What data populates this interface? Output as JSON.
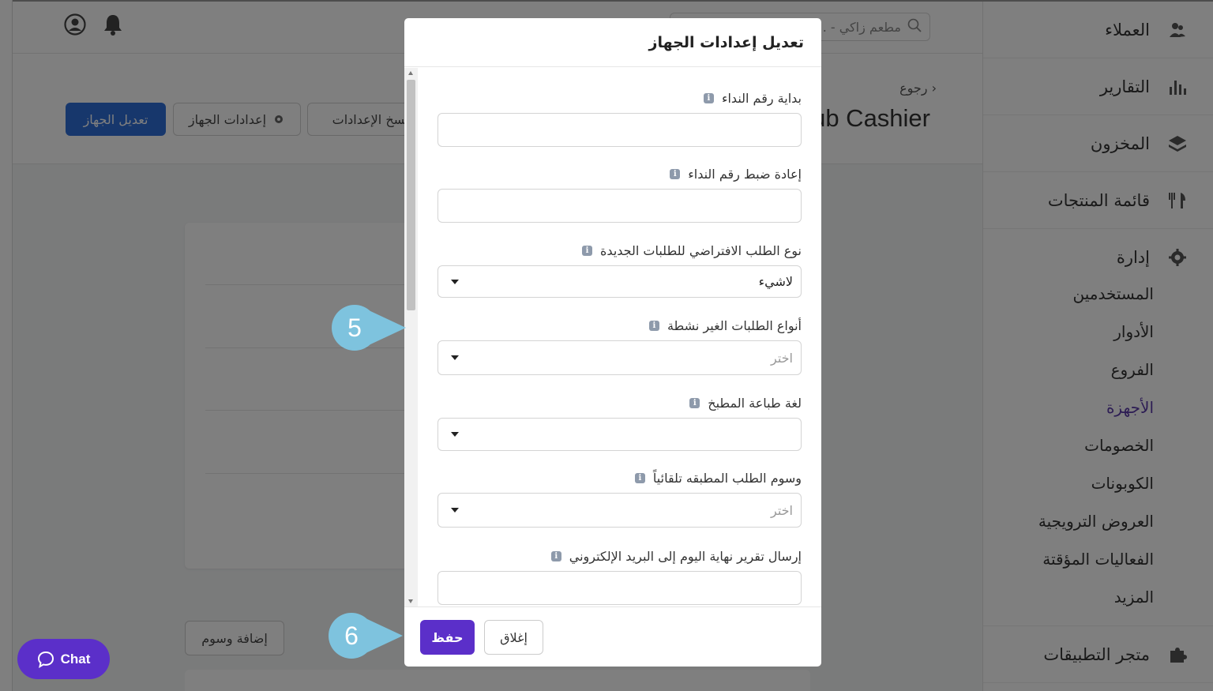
{
  "sidebar": {
    "items_top": [
      {
        "label": "العملاء",
        "icon": "customers-icon"
      },
      {
        "label": "التقارير",
        "icon": "reports-icon"
      },
      {
        "label": "المخزون",
        "icon": "inventory-icon"
      },
      {
        "label": "قائمة المنتجات",
        "icon": "menu-icon"
      }
    ],
    "management": {
      "label": "إدارة",
      "subitems": [
        "المستخدمين",
        "الأدوار",
        "الفروع",
        "الأجهزة",
        "الخصومات",
        "الكوبونات",
        "العروض الترويجية",
        "الفعاليات المؤقتة",
        "المزيد"
      ],
      "active": "الأجهزة"
    },
    "marketplace": {
      "label": "متجر التطبيقات"
    }
  },
  "topbar": {
    "search_placeholder": "مطعم زاكي - ..."
  },
  "header": {
    "back": "رجوع",
    "device_title": "Sub Cashier",
    "buttons": {
      "edit_device": "تعديل الجهاز",
      "device_settings": "إعدادات الجهاز",
      "copy_settings": "نسخ الإعدادات"
    }
  },
  "page": {
    "add_tags": "إضافة وسوم"
  },
  "modal": {
    "title": "تعديل إعدادات الجهاز",
    "fields": [
      {
        "label": "بداية رقم النداء",
        "value": "",
        "type": "input"
      },
      {
        "label": "إعادة ضبط رقم النداء",
        "value": "",
        "type": "input"
      },
      {
        "label": "نوع الطلب الافتراضي للطلبات الجديدة",
        "value": "لاشيء",
        "type": "select"
      },
      {
        "label": "أنواع الطلبات الغير نشطة",
        "placeholder": "اختر",
        "type": "multiselect"
      },
      {
        "label": "لغة طباعة المطبخ",
        "value": "",
        "type": "select"
      },
      {
        "label": "وسوم الطلب المطبقه تلقائياً",
        "placeholder": "اختر",
        "type": "multiselect"
      },
      {
        "label": "إرسال تقرير نهاية اليوم إلى البريد الإلكتروني",
        "value": "",
        "type": "input"
      }
    ],
    "save": "حفظ",
    "close": "إغلاق"
  },
  "callouts": [
    "5",
    "6"
  ],
  "chat": {
    "label": "Chat"
  },
  "colors": {
    "primary": "#5b2fc9",
    "blue": "#2f6fd8",
    "callout": "#7ec3de",
    "active_nav": "#5b3aa8"
  }
}
